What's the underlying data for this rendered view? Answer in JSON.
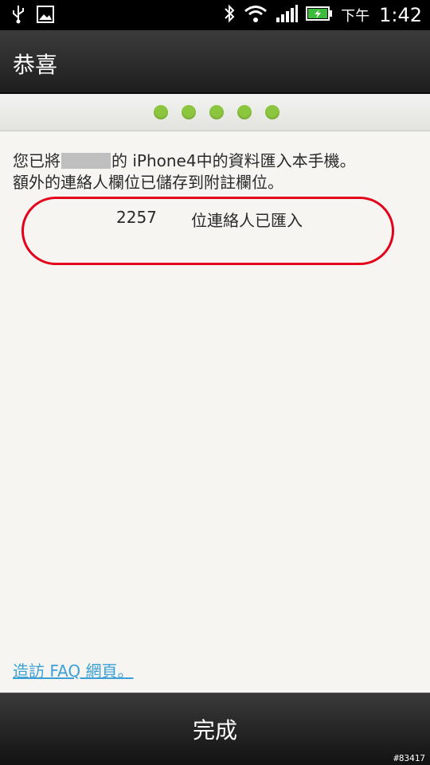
{
  "status_bar": {
    "icons_left": [
      "usb-icon",
      "image-icon"
    ],
    "icons_right": [
      "bluetooth-icon",
      "wifi-icon",
      "signal-icon",
      "battery-icon"
    ],
    "ampm": "下午",
    "time": "1:42"
  },
  "header": {
    "title": "恭喜"
  },
  "steps": {
    "total": 5,
    "color": "#8cc63f"
  },
  "message": {
    "line1_prefix": "您已將",
    "line1_suffix": "的 iPhone4中的資料匯入本手機。",
    "line2": "額外的連絡人欄位已儲存到附註欄位。"
  },
  "import_result": {
    "count": "2257",
    "label": "位連絡人已匯入",
    "highlight_color": "#e3001b"
  },
  "faq_link": "造訪 FAQ 網頁。",
  "footer": {
    "done_label": "完成",
    "watermark": "#83417"
  }
}
